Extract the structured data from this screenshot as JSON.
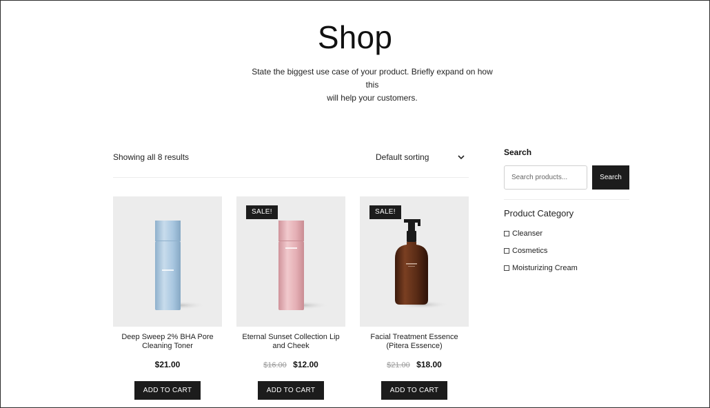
{
  "header": {
    "title": "Shop",
    "subtitle_line1": "State the biggest use case of your product. Briefly expand on how this",
    "subtitle_line2": "will help your customers."
  },
  "toolbar": {
    "results_text": "Showing all 8 results",
    "sort_label": "Default sorting"
  },
  "products": [
    {
      "title_line1": "Deep Sweep 2% BHA Pore",
      "title_line2": "Cleaning Toner",
      "sale_badge": "",
      "price_old": "",
      "price": "$21.00",
      "button": "ADD TO CART",
      "image": "blue-toner-bottle"
    },
    {
      "title_line1": "Eternal Sunset Collection Lip",
      "title_line2": "and Cheek",
      "sale_badge": "SALE!",
      "price_old": "$16.00",
      "price": "$12.00",
      "button": "ADD TO CART",
      "image": "pink-bottle"
    },
    {
      "title_line1": "Facial Treatment Essence",
      "title_line2": "(Pitera Essence)",
      "sale_badge": "SALE!",
      "price_old": "$21.00",
      "price": "$18.00",
      "button": "ADD TO CART",
      "image": "amber-pump-bottle"
    }
  ],
  "sidebar": {
    "search_title": "Search",
    "search_placeholder": "Search products...",
    "search_button": "Search",
    "category_title": "Product Category",
    "categories": [
      "Cleanser",
      "Cosmetics",
      "Moisturizing Cream"
    ]
  },
  "colors": {
    "button_bg": "#1c1c1c",
    "image_bg": "#ececec",
    "blue_bottle": "#a9c7e0",
    "pink_bottle": "#e4aeb4",
    "amber_bottle": "#5a2c16"
  }
}
